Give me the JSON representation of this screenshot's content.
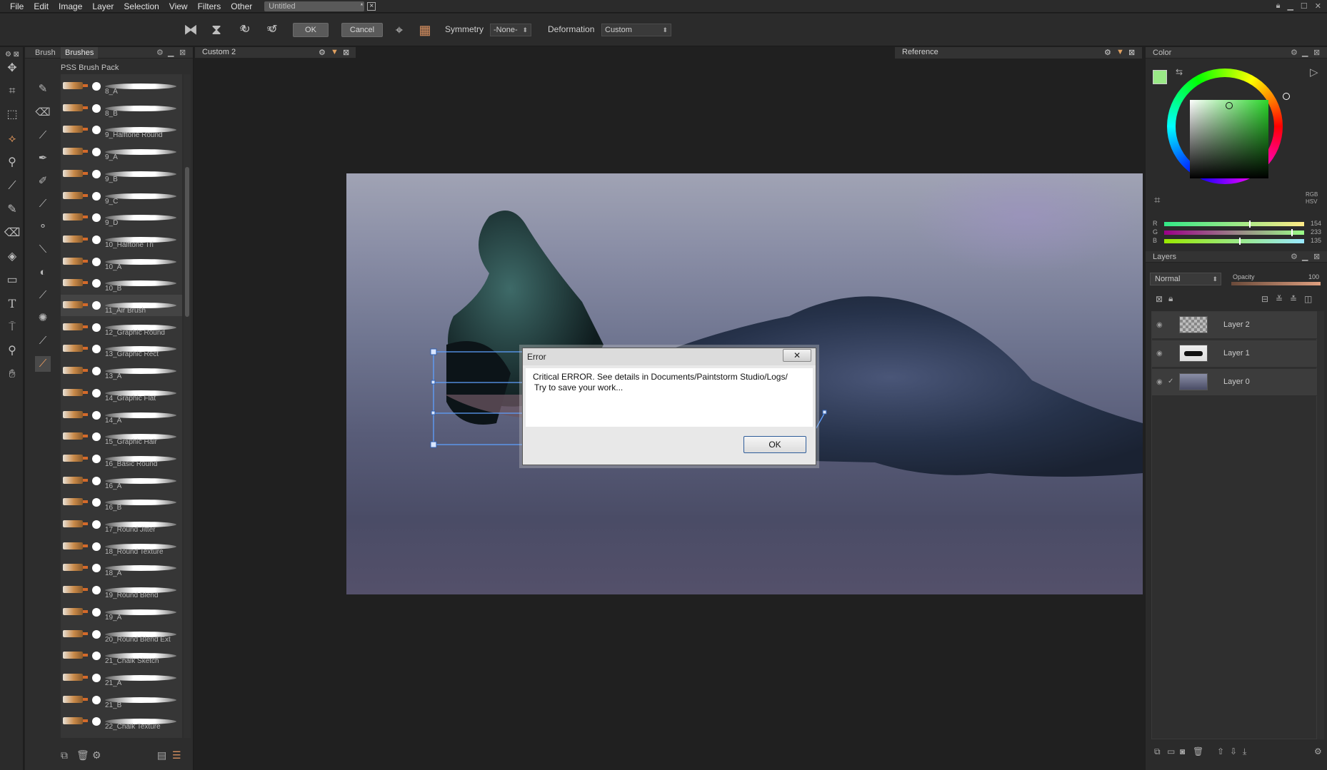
{
  "menu": [
    "File",
    "Edit",
    "Image",
    "Layer",
    "Selection",
    "View",
    "Filters",
    "Other"
  ],
  "document_tab": "Untitled",
  "toolbar": {
    "rotate_cw": "90",
    "rotate_ccw": "90",
    "ok": "OK",
    "cancel": "Cancel",
    "symmetry_label": "Symmetry",
    "symmetry_value": "-None-",
    "deformation_label": "Deformation",
    "deformation_value": "Custom"
  },
  "brush_panel": {
    "tabs": [
      "Brush",
      "Brushes"
    ],
    "pack_title": "PSS Brush Pack",
    "brushes": [
      "8_A",
      "8_B",
      "9_Halftone Round",
      "9_A",
      "9_B",
      "9_C",
      "9_D",
      "10_Halftone Tri",
      "10_A",
      "10_B",
      "11_Air Brush",
      "12_Graphic Round",
      "13_Graphic Rect",
      "13_A",
      "14_Graphic Flat",
      "14_A",
      "15_Graphic Hair",
      "16_Basic Round",
      "16_A",
      "16_B",
      "17_Round Jitter",
      "18_Round Texture",
      "18_A",
      "19_Round Blend",
      "19_A",
      "20_Round Blend Ext",
      "21_Chalk Sketch",
      "21_A",
      "21_B",
      "22_Chalk Texture"
    ],
    "selected_brush": "11_Air Brush"
  },
  "canvas_tab": "Custom 2",
  "reference_tab": "Reference",
  "dialog": {
    "title": "Error",
    "close": "✕",
    "message_line1": "Critical ERROR. See details in Documents/Paintstorm Studio/Logs/",
    "message_line2": "Try to save your work...",
    "ok": "OK"
  },
  "color_panel": {
    "title": "Color",
    "mode_rgb": "RGB",
    "mode_hsv": "HSV",
    "current_color": "#9ae987",
    "channels": [
      {
        "label": "R",
        "value": "154"
      },
      {
        "label": "G",
        "value": "233"
      },
      {
        "label": "B",
        "value": "135"
      }
    ]
  },
  "layers_panel": {
    "title": "Layers",
    "blend_mode": "Normal",
    "opacity_label": "Opacity",
    "opacity_value": "100",
    "layers": [
      "Layer 2",
      "Layer 1",
      "Layer 0"
    ]
  }
}
